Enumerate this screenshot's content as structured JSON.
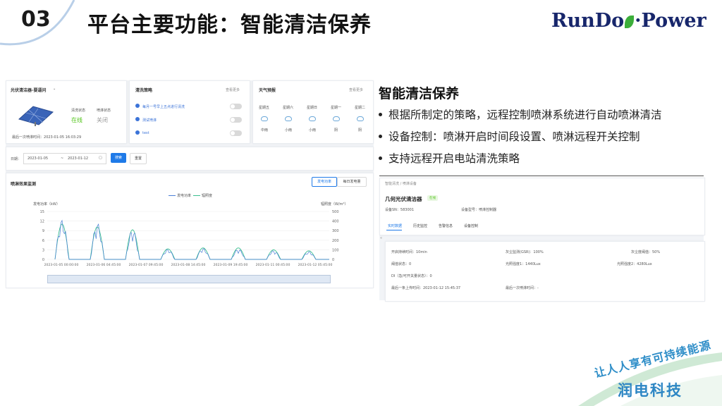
{
  "slide": {
    "number": "03",
    "title": "平台主要功能：智能清洁保养",
    "logo_text_left": "RunDo",
    "logo_text_right": "Power",
    "slogan": "让人人享有可持续能源",
    "brand_cn": "润电科技"
  },
  "intro": {
    "title": "智能清洁保养",
    "bullets": [
      "根据所制定的策略，远程控制喷淋系统进行自动喷淋清洁",
      "设备控制：喷淋开启时间段设置、喷淋远程开关控制",
      "支持远程开启电站清洗策略"
    ]
  },
  "device_card": {
    "selector": "光伏清洁器-要逼问",
    "clean_status_label": "清洗状态",
    "clean_status_value": "在线",
    "spray_status_label": "喷淋状态",
    "spray_status_value": "关闭",
    "last_spray_label": "最后一次喷淋时间：",
    "last_spray_value": "2023-01-05 16:03:29"
  },
  "strategy": {
    "title": "清洗策略",
    "more": "查看更多",
    "items": [
      "每月一号早上五点进行清洗",
      "测试喷淋",
      "test"
    ]
  },
  "weather": {
    "title": "天气预报",
    "more": "查看更多",
    "days": [
      {
        "day": "星期五",
        "cond": "中雨"
      },
      {
        "day": "星期六",
        "cond": "小雨"
      },
      {
        "day": "星期日",
        "cond": "小雨"
      },
      {
        "day": "星期一",
        "cond": "阴"
      },
      {
        "day": "星期二",
        "cond": "阴"
      }
    ]
  },
  "filter": {
    "date_label": "日期：",
    "start": "2023-01-05",
    "sep": "~",
    "end": "2023-01-12",
    "search_btn": "搜索",
    "reset_btn": "重置"
  },
  "chart_panel": {
    "title": "喷淋效果监测",
    "tab_power": "发电功率",
    "tab_energy": "每日发电量",
    "legend": [
      "发电功率",
      "辐照度"
    ],
    "left_unit": "发电功率（kW）",
    "right_unit": "辐照度（W/m²）"
  },
  "chart_data": {
    "type": "line",
    "title": "",
    "ylim_left": [
      0,
      15
    ],
    "ylim_right": [
      0,
      500
    ],
    "left_ticks": [
      "15",
      "12",
      "9",
      "6",
      "3",
      "0"
    ],
    "right_ticks": [
      "500",
      "400",
      "300",
      "200",
      "100",
      "0"
    ],
    "x_labels": [
      "2023-01-05 00:00:00",
      "2023-01-06 04:45:00",
      "2023-01-07 09:45:00",
      "2023-01-08 14:45:00",
      "2023-01-09 19:45:00",
      "2023-01-11 00:45:00",
      "2023-01-12 05:45:00"
    ],
    "series": [
      {
        "name": "发电功率",
        "color": "#4a7fd6",
        "daily_peak": [
          12.5,
          11.5,
          9.5,
          3.2,
          3.5,
          3.3,
          2.8,
          2.5
        ]
      },
      {
        "name": "辐照度",
        "color": "#3bbf8f",
        "daily_peak": [
          370,
          340,
          310,
          110,
          120,
          120,
          100,
          90
        ]
      }
    ]
  },
  "detail": {
    "breadcrumb": "智能清洗 / 喷淋设备",
    "device_name": "几何光伏清洁器",
    "status_badge": "在线",
    "sn_label": "设备SN：",
    "sn_value": "583001",
    "model_label": "设备型号：",
    "model_value": "喷淋控制器",
    "tabs": [
      "实时数据",
      "历史监控",
      "告警信息",
      "设备控制"
    ],
    "fields": [
      "开启持续时间：10min",
      "灰尘监测(GSR)：100%",
      "灰尘度阈值：50%",
      "阈值状态：0",
      "光照强度1：1440Lux",
      "光照强度2：4280Lux",
      "DI（急/可开关量状态）：0",
      "最后一条上传时间：2023-01-12 15:45:37",
      "最后一次喷淋时间：-"
    ]
  }
}
